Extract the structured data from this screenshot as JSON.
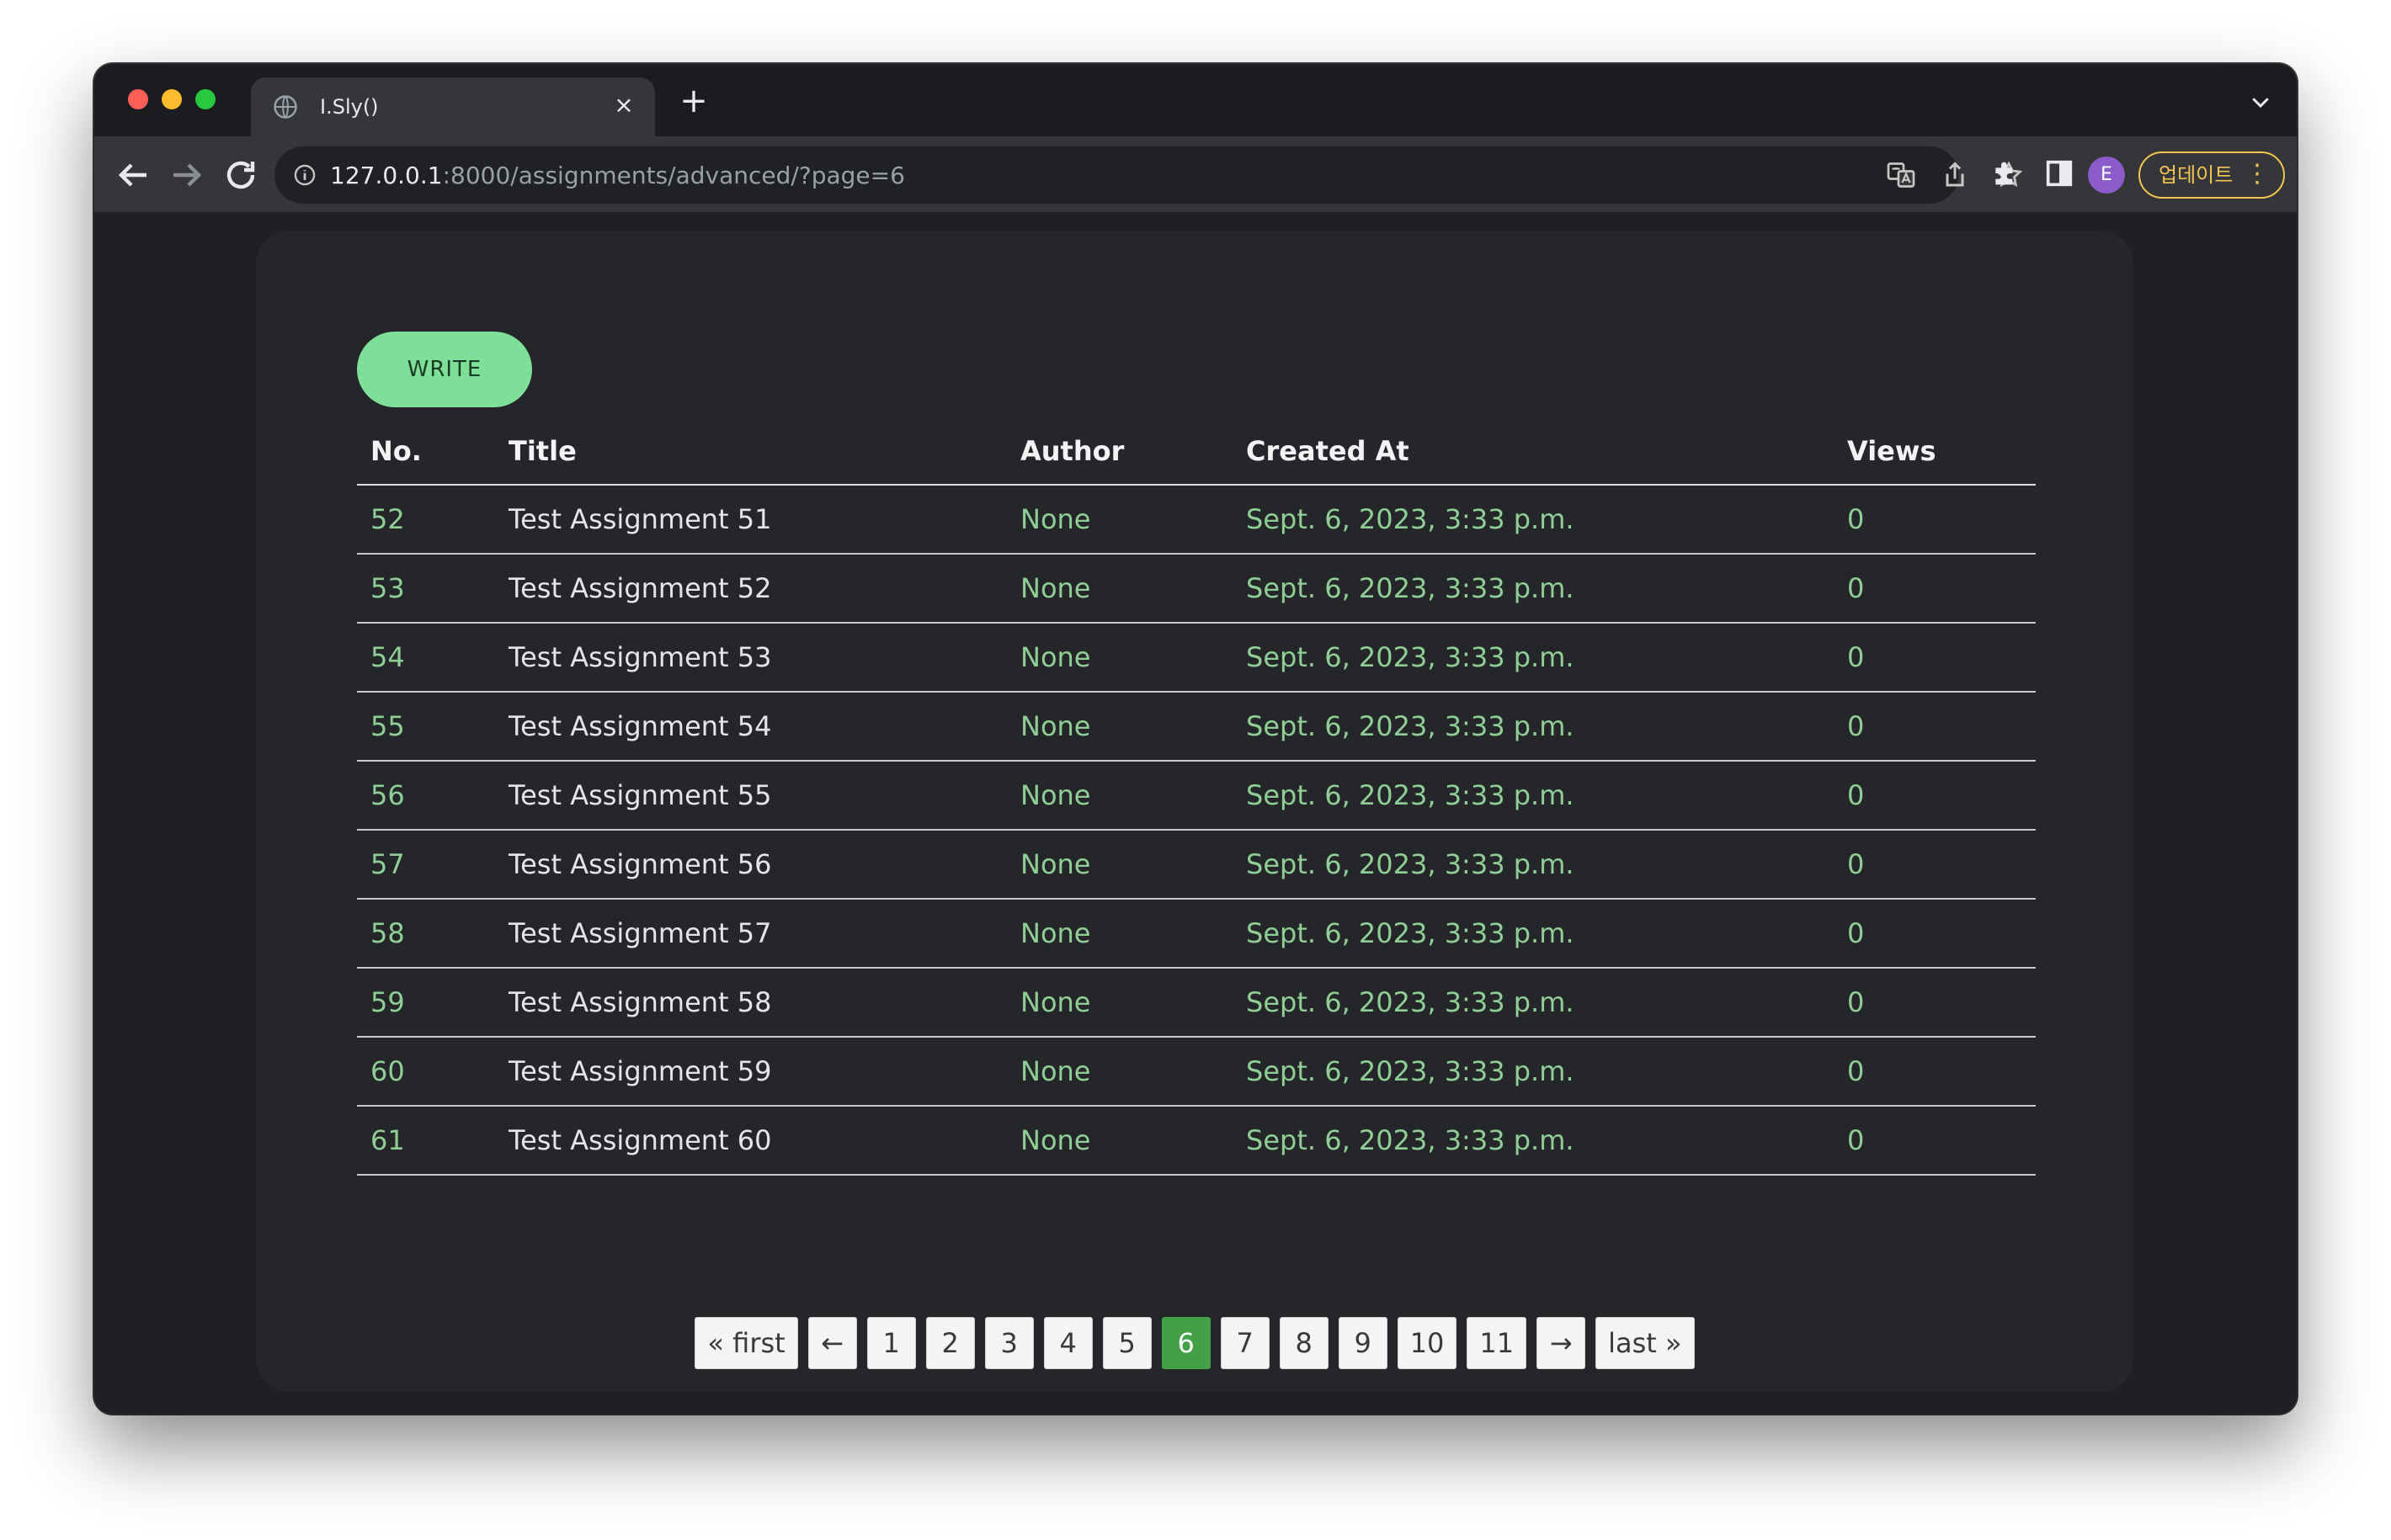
{
  "browser": {
    "tab_title": "I.Sly()",
    "tab_close": "×",
    "new_tab": "+",
    "url_host": "127.0.0.1",
    "url_rest": ":8000/assignments/advanced/?page=6",
    "avatar_letter": "E",
    "update_label": "업데이트",
    "update_menu": "⋮"
  },
  "icons": {
    "tab": "globe-icon",
    "nav": [
      "back-arrow-icon",
      "forward-arrow-icon",
      "reload-icon"
    ],
    "omnibox": [
      "info-icon",
      "translate-icon",
      "share-icon",
      "star-icon"
    ],
    "toolbar": [
      "puzzle-extension-icon",
      "side-panel-icon"
    ]
  },
  "page": {
    "write_label": "WRITE",
    "columns": [
      "No.",
      "Title",
      "Author",
      "Created At",
      "Views"
    ],
    "rows": [
      {
        "no": "52",
        "title": "Test Assignment 51",
        "author": "None",
        "created": "Sept. 6, 2023, 3:33 p.m.",
        "views": "0"
      },
      {
        "no": "53",
        "title": "Test Assignment 52",
        "author": "None",
        "created": "Sept. 6, 2023, 3:33 p.m.",
        "views": "0"
      },
      {
        "no": "54",
        "title": "Test Assignment 53",
        "author": "None",
        "created": "Sept. 6, 2023, 3:33 p.m.",
        "views": "0"
      },
      {
        "no": "55",
        "title": "Test Assignment 54",
        "author": "None",
        "created": "Sept. 6, 2023, 3:33 p.m.",
        "views": "0"
      },
      {
        "no": "56",
        "title": "Test Assignment 55",
        "author": "None",
        "created": "Sept. 6, 2023, 3:33 p.m.",
        "views": "0"
      },
      {
        "no": "57",
        "title": "Test Assignment 56",
        "author": "None",
        "created": "Sept. 6, 2023, 3:33 p.m.",
        "views": "0"
      },
      {
        "no": "58",
        "title": "Test Assignment 57",
        "author": "None",
        "created": "Sept. 6, 2023, 3:33 p.m.",
        "views": "0"
      },
      {
        "no": "59",
        "title": "Test Assignment 58",
        "author": "None",
        "created": "Sept. 6, 2023, 3:33 p.m.",
        "views": "0"
      },
      {
        "no": "60",
        "title": "Test Assignment 59",
        "author": "None",
        "created": "Sept. 6, 2023, 3:33 p.m.",
        "views": "0"
      },
      {
        "no": "61",
        "title": "Test Assignment 60",
        "author": "None",
        "created": "Sept. 6, 2023, 3:33 p.m.",
        "views": "0"
      }
    ],
    "pagination": {
      "first": "« first",
      "prev": "←",
      "pages": [
        "1",
        "2",
        "3",
        "4",
        "5",
        "6",
        "7",
        "8",
        "9",
        "10",
        "11"
      ],
      "current": "6",
      "next": "→",
      "last": "last »"
    }
  },
  "colors": {
    "accent_green": "#7ee098",
    "active_page": "#43a047",
    "cell_green": "#8fcf95",
    "update_yellow": "#f6c453"
  }
}
